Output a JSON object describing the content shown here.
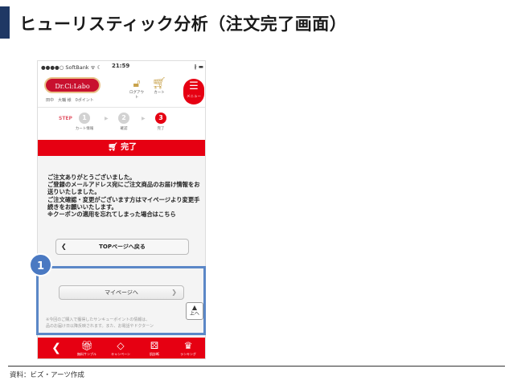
{
  "slide": {
    "title": "ヒューリスティック分析（注文完了画面）",
    "source": "資料：ビズ・アーツ作成",
    "badge_number": "1"
  },
  "status_bar": {
    "carrier": "●●●●○ SoftBank ᯤ ☾",
    "time": "21:59",
    "right": "∦ ▬"
  },
  "header": {
    "logo_text": "Dr.Ci:Labo",
    "points_text": "田中　大輔 様　0ポイント",
    "logout_label": "ログアウト",
    "cart_label": "カート",
    "menu_label": "メニュー"
  },
  "steps": {
    "label": "STEP",
    "items": [
      {
        "number": "1",
        "label": "カート情報"
      },
      {
        "number": "2",
        "label": "確認"
      },
      {
        "number": "3",
        "label": "完了"
      }
    ]
  },
  "complete_banner": "完了",
  "thanks_message": "ご注文ありがとうございました。\nご登録のメールアドレス宛にご注文商品のお届け情報をお送りいたしました。\nご注文確認・変更がございます方はマイページより変更手続きをお願いいたします。\n※クーポンの適用を忘れてしまった場合はこちら",
  "buttons": {
    "top_page": "TOPページへ戻る",
    "my_page": "マイページへ",
    "to_top": "上へ"
  },
  "fine_print": "※今回のご購入で獲得したサンキューポイントの情報は、\n品のお届け日以降反映されます。また、お電話やドクターン",
  "tabbar": {
    "items": [
      {
        "label": "無料サンプル",
        "icon": "gift-icon"
      },
      {
        "label": "キャンペーン",
        "icon": "diamond-icon"
      },
      {
        "label": "肌診断",
        "icon": "dice-icon"
      },
      {
        "label": "ランキング",
        "icon": "crown-icon"
      }
    ]
  },
  "colors": {
    "accent_red": "#e60012",
    "highlight_blue": "#5b87c7",
    "title_bar_navy": "#1f3864"
  }
}
